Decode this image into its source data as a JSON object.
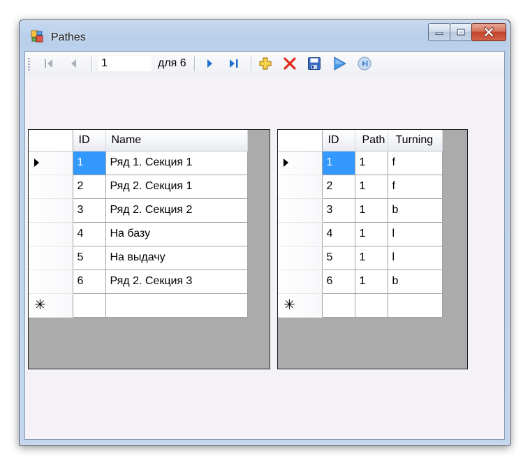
{
  "window": {
    "title": "Pathes"
  },
  "navigator": {
    "position_value": "1",
    "count_label": "для 6"
  },
  "grid_left": {
    "columns": [
      "ID",
      "Name"
    ],
    "rows": [
      [
        "1",
        "Ряд 1. Секция 1"
      ],
      [
        "2",
        "Ряд 2. Секция 1"
      ],
      [
        "3",
        "Ряд 2. Секция 2"
      ],
      [
        "4",
        "На базу"
      ],
      [
        "5",
        "На выдачу"
      ],
      [
        "6",
        "Ряд 2. Секция 3"
      ]
    ]
  },
  "grid_right": {
    "columns": [
      "ID",
      "Path",
      "Turning"
    ],
    "rows": [
      [
        "1",
        "1",
        "f"
      ],
      [
        "2",
        "1",
        "f"
      ],
      [
        "3",
        "1",
        "b"
      ],
      [
        "4",
        "1",
        "l"
      ],
      [
        "5",
        "1",
        "l"
      ],
      [
        "6",
        "1",
        "b"
      ]
    ]
  },
  "icons": {
    "app": "app-icon",
    "move_first": "move-first-icon",
    "move_previous": "move-previous-icon",
    "move_next": "move-next-icon",
    "move_last": "move-last-icon",
    "add_new": "add-icon",
    "delete": "delete-icon",
    "save": "save-icon",
    "run": "run-icon",
    "stop": "stop-icon"
  },
  "colors": {
    "selection": "#3399ff",
    "grid_background": "#ababab",
    "client_background": "#f4f2f6",
    "close_button": "#c2442a"
  }
}
